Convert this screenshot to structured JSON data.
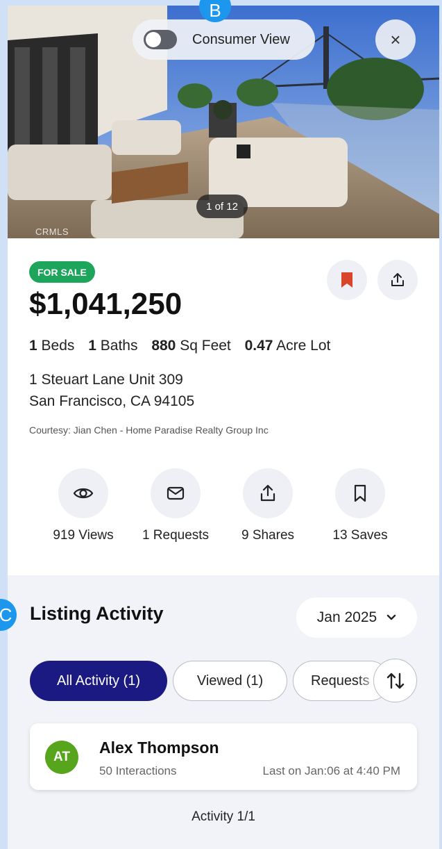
{
  "markers": {
    "b": "B",
    "c": "C"
  },
  "hero": {
    "toggle_label": "Consumer View",
    "toggle_on": false,
    "close_icon": "×",
    "photo_counter": "1 of 12",
    "watermark": "CRMLS"
  },
  "listing": {
    "status": "FOR SALE",
    "price": "$1,041,250",
    "beds_value": "1",
    "beds_label": "Beds",
    "baths_value": "1",
    "baths_label": "Baths",
    "sqft_value": "880",
    "sqft_label": "Sq Feet",
    "lot_value": "0.47",
    "lot_label": "Acre Lot",
    "address_line1": "1 Steuart Lane Unit 309",
    "address_line2": "San Francisco, CA 94105",
    "courtesy": "Courtesy: Jian Chen - Home Paradise Realty Group Inc"
  },
  "stats": [
    {
      "icon": "eye-icon",
      "label": "919 Views"
    },
    {
      "icon": "mail-icon",
      "label": "1 Requests"
    },
    {
      "icon": "share-icon",
      "label": "9 Shares"
    },
    {
      "icon": "bookmark-icon",
      "label": "13 Saves"
    }
  ],
  "activity": {
    "title": "Listing Activity",
    "month": "Jan 2025",
    "tabs": [
      "All Activity (1)",
      "Viewed (1)",
      "Requests"
    ],
    "entries": [
      {
        "initials": "AT",
        "name": "Alex Thompson",
        "interactions": "50 Interactions",
        "last": "Last on Jan:06 at 4:40 PM"
      }
    ],
    "footer": "Activity 1/1"
  },
  "colors": {
    "accent": "#1b1a82",
    "sale_badge": "#1ea55c",
    "saved_bookmark": "#d9452b",
    "avatar": "#56a51d"
  }
}
